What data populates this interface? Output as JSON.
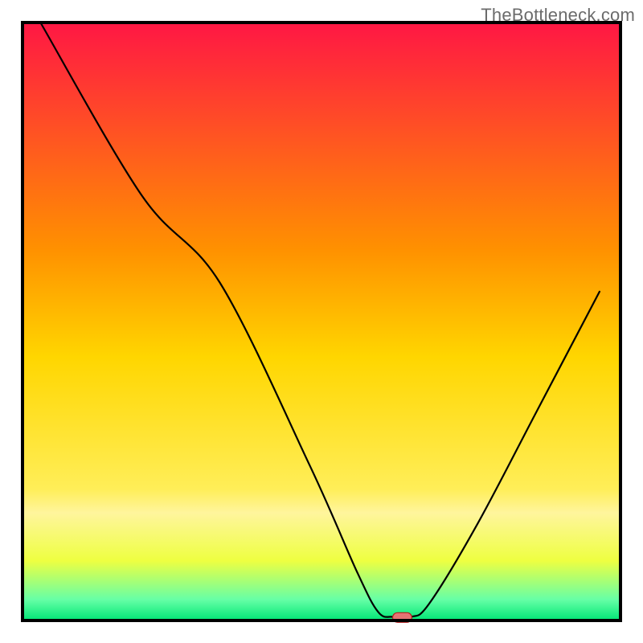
{
  "watermark": "TheBottleneck.com",
  "chart_data": {
    "type": "line",
    "title": "",
    "xlabel": "",
    "ylabel": "",
    "xlim": [
      0,
      100
    ],
    "ylim": [
      0,
      100
    ],
    "grid": false,
    "background": {
      "type": "vertical-gradient",
      "stops": [
        {
          "offset": 0.0,
          "color": "#ff1744"
        },
        {
          "offset": 0.38,
          "color": "#ff9100"
        },
        {
          "offset": 0.56,
          "color": "#ffd600"
        },
        {
          "offset": 0.78,
          "color": "#ffee58"
        },
        {
          "offset": 0.82,
          "color": "#fff59d"
        },
        {
          "offset": 0.9,
          "color": "#eeff41"
        },
        {
          "offset": 0.965,
          "color": "#66ffa6"
        },
        {
          "offset": 1.0,
          "color": "#00e676"
        }
      ]
    },
    "series": [
      {
        "name": "bottleneck-curve",
        "stroke": "#000000",
        "stroke_width": 2.2,
        "points": [
          {
            "x": 3.0,
            "y": 100.0
          },
          {
            "x": 20.0,
            "y": 71.0
          },
          {
            "x": 33.0,
            "y": 56.5
          },
          {
            "x": 48.0,
            "y": 26.0
          },
          {
            "x": 56.0,
            "y": 8.0
          },
          {
            "x": 59.5,
            "y": 1.4
          },
          {
            "x": 62.0,
            "y": 0.6
          },
          {
            "x": 65.0,
            "y": 0.6
          },
          {
            "x": 68.0,
            "y": 2.8
          },
          {
            "x": 76.0,
            "y": 16.0
          },
          {
            "x": 86.0,
            "y": 35.0
          },
          {
            "x": 96.5,
            "y": 55.0
          }
        ]
      }
    ],
    "markers": [
      {
        "name": "optimal-point",
        "shape": "rounded-rect",
        "cx": 63.5,
        "cy": 0.5,
        "width": 3.2,
        "height": 1.6,
        "fill": "#e57373",
        "stroke": "#b71c1c"
      }
    ],
    "axes": {
      "show_border": true,
      "border_color": "#000000",
      "border_width": 4
    }
  }
}
